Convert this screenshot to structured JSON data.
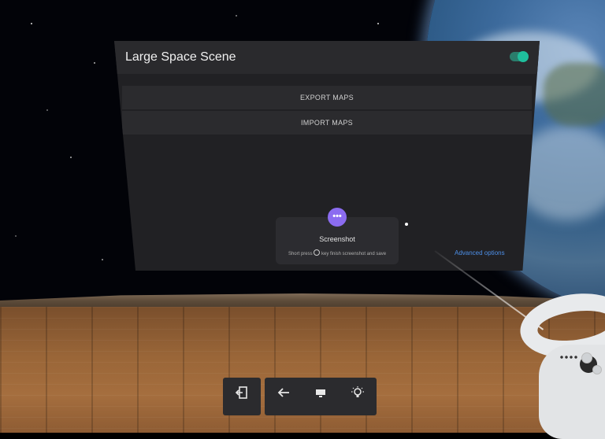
{
  "panel": {
    "title": "Large Space Scene",
    "toggle_on": true,
    "menu": [
      {
        "label": "EXPORT MAPS"
      },
      {
        "label": "IMPORT MAPS"
      }
    ],
    "advanced_label": "Advanced options"
  },
  "toast": {
    "badge": "•••",
    "title": "Screenshot",
    "subtitle_prefix": "Short press",
    "subtitle_suffix": "key finish screenshot and save"
  },
  "dock": {
    "exit_icon": "exit-icon",
    "back_icon": "back-arrow-icon",
    "screen_icon": "monitor-icon",
    "bulb_icon": "lightbulb-icon"
  },
  "colors": {
    "panel_bg": "#212124",
    "toggle": "#1fbf9d",
    "badge": "#8b6cf0",
    "link": "#4d8fe8"
  }
}
